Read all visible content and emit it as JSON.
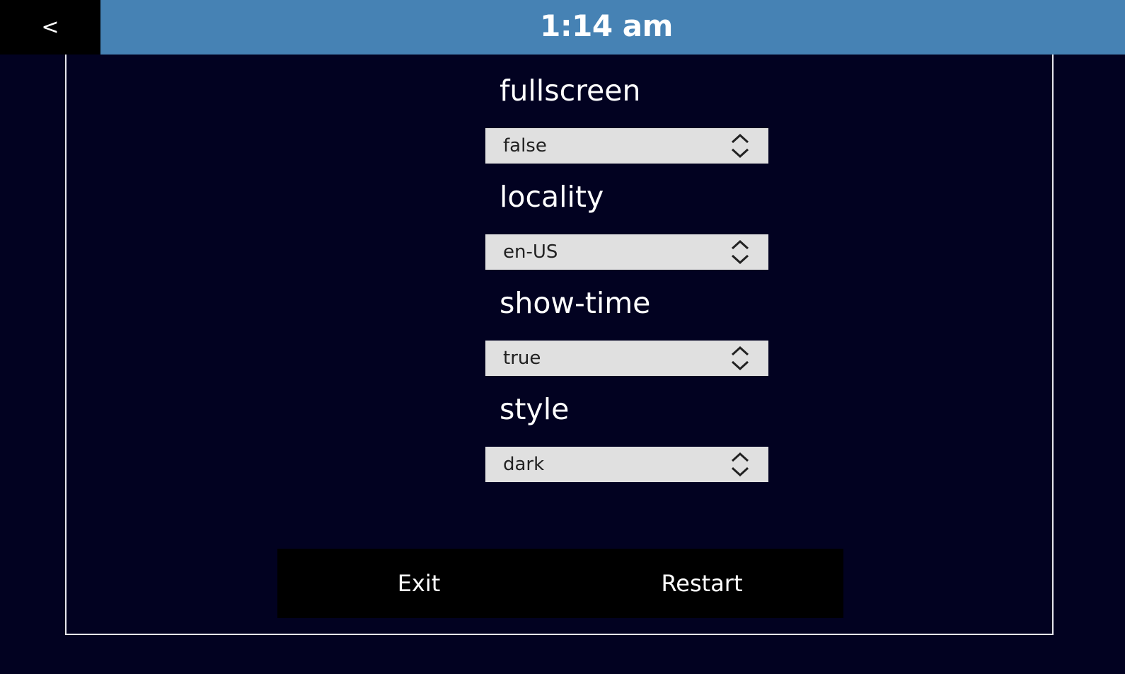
{
  "header": {
    "back_label": "<",
    "clock": "1:14 am"
  },
  "settings": [
    {
      "label": "fullscreen",
      "value": "false"
    },
    {
      "label": "locality",
      "value": "en-US"
    },
    {
      "label": "show-time",
      "value": "true"
    },
    {
      "label": "style",
      "value": "dark"
    }
  ],
  "actions": {
    "exit_label": "Exit",
    "restart_label": "Restart"
  },
  "colors": {
    "background": "#020221",
    "header": "#4682b4",
    "select_bg": "#e0e0e0"
  },
  "icons": {
    "select_arrows": "up-down-chevron-icon"
  }
}
